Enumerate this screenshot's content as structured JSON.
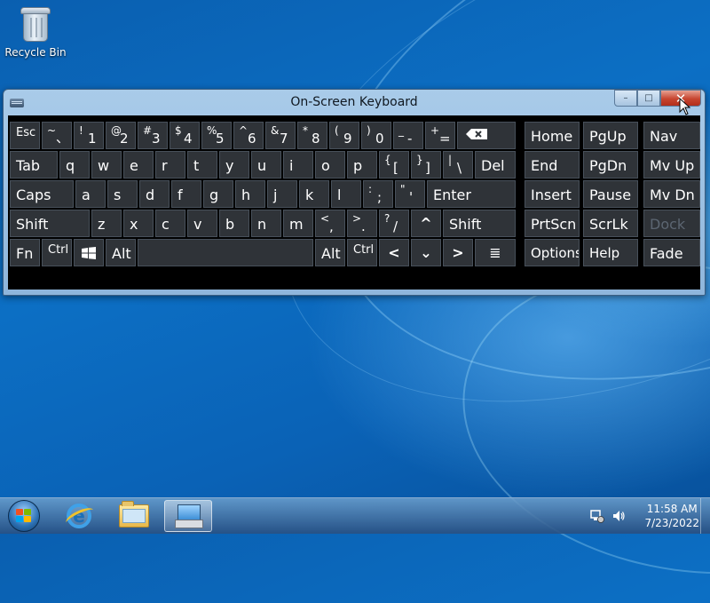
{
  "desktop": {
    "icons": [
      {
        "label": "Recycle Bin",
        "icon": "recycle-bin-icon"
      }
    ]
  },
  "window": {
    "title": "On-Screen Keyboard",
    "controls": {
      "minimize": "–",
      "maximize": "□",
      "close": "✕"
    }
  },
  "keyboard": {
    "row1": {
      "esc": "Esc",
      "tilde": {
        "sup": "~",
        "main": "、"
      },
      "k1": {
        "sup": "!",
        "main": "1"
      },
      "k2": {
        "sup": "@",
        "main": "2"
      },
      "k3": {
        "sup": "#",
        "main": "3"
      },
      "k4": {
        "sup": "$",
        "main": "4"
      },
      "k5": {
        "sup": "%",
        "main": "5"
      },
      "k6": {
        "sup": "^",
        "main": "6"
      },
      "k7": {
        "sup": "&",
        "main": "7"
      },
      "k8": {
        "sup": "*",
        "main": "8"
      },
      "k9": {
        "sup": "(",
        "main": "9"
      },
      "k0": {
        "sup": ")",
        "main": "0"
      },
      "minus": {
        "sup": "_",
        "main": "-"
      },
      "equals": {
        "sup": "+",
        "main": "="
      },
      "backspace_icon": "backspace-icon",
      "home": "Home",
      "pgup": "PgUp",
      "nav": "Nav"
    },
    "row2": {
      "tab": "Tab",
      "letters": [
        "q",
        "w",
        "e",
        "r",
        "t",
        "y",
        "u",
        "i",
        "o",
        "p"
      ],
      "lbracket": {
        "sup": "{",
        "main": "["
      },
      "rbracket": {
        "sup": "}",
        "main": "]"
      },
      "backslash": {
        "sup": "|",
        "main": "\\"
      },
      "del": "Del",
      "end": "End",
      "pgdn": "PgDn",
      "mvup": "Mv Up"
    },
    "row3": {
      "caps": "Caps",
      "letters": [
        "a",
        "s",
        "d",
        "f",
        "g",
        "h",
        "j",
        "k",
        "l"
      ],
      "semicolon": {
        "sup": ":",
        "main": ";"
      },
      "quote": {
        "sup": "\"",
        "main": "'"
      },
      "enter": "Enter",
      "insert": "Insert",
      "pause": "Pause",
      "mvdn": "Mv Dn"
    },
    "row4": {
      "shift_left": "Shift",
      "letters": [
        "z",
        "x",
        "c",
        "v",
        "b",
        "n",
        "m"
      ],
      "comma": {
        "sup": "<",
        "main": ","
      },
      "period": {
        "sup": ">",
        "main": "."
      },
      "slash": {
        "sup": "?",
        "main": "/"
      },
      "up_arrow": "^",
      "shift_right": "Shift",
      "prtscn": "PrtScn",
      "scrlk": "ScrLk",
      "dock": "Dock"
    },
    "row5": {
      "fn": "Fn",
      "ctrl_left": "Ctrl",
      "alt_left": "Alt",
      "space": "",
      "alt_right": "Alt",
      "ctrl_right": "Ctrl",
      "left_arrow": "<",
      "down_arrow": "⌄",
      "right_arrow": ">",
      "menu": "≣",
      "options": "Options",
      "help": "Help",
      "fade": "Fade"
    }
  },
  "taskbar": {
    "start": "windows-start-icon",
    "apps": [
      {
        "name": "Internet Explorer",
        "icon": "internet-explorer-icon"
      },
      {
        "name": "Windows Explorer",
        "icon": "folder-icon"
      },
      {
        "name": "On-Screen Keyboard",
        "icon": "on-screen-keyboard-icon",
        "active": true
      }
    ],
    "tray": {
      "network_icon": "network-icon",
      "volume_icon": "volume-icon"
    },
    "clock": {
      "time": "11:58 AM",
      "date": "7/23/2022"
    }
  }
}
